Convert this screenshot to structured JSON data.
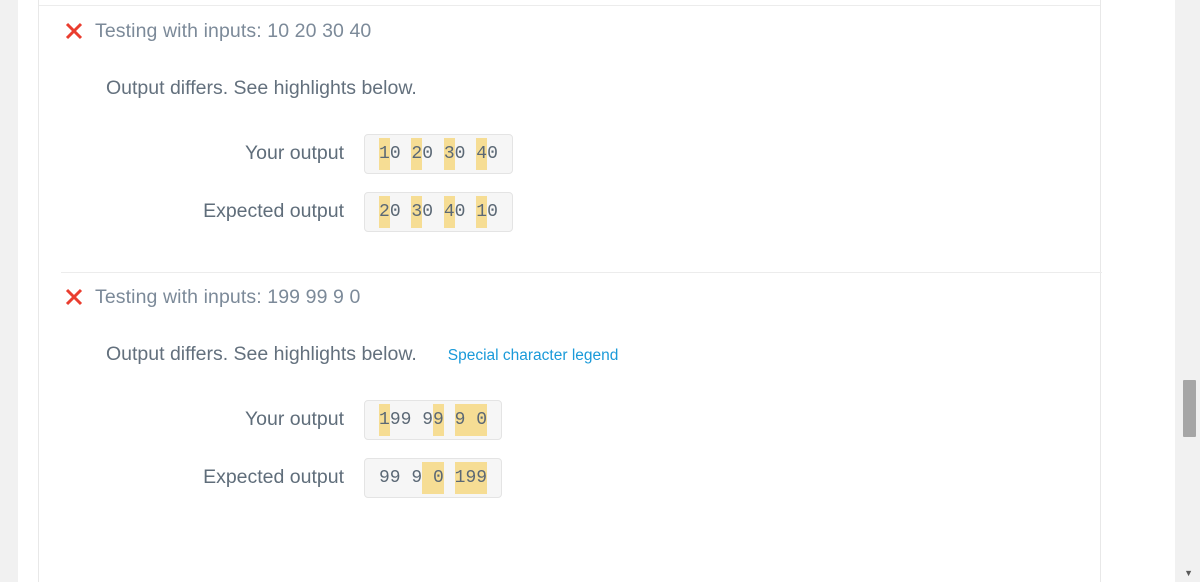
{
  "scrollbar": {
    "down_arrow_glyph": "▼"
  },
  "icons": {
    "fail": "x-mark-icon",
    "fail_color": "#ea3d2f"
  },
  "colors": {
    "highlight": "#f6dd94",
    "link": "#1a9ad9",
    "text_muted": "#7c8a99",
    "box_background": "#f6f6f6",
    "box_border": "#e4e4e4"
  },
  "labels": {
    "your_output": "Your output",
    "expected_output": "Expected output"
  },
  "test_cases": [
    {
      "status": "fail",
      "title": "Testing with inputs: 10 20 30 40",
      "message": "Output differs. See highlights below.",
      "legend_link": null,
      "your_output": [
        {
          "text": "1",
          "highlight": true
        },
        {
          "text": "0 ",
          "highlight": false
        },
        {
          "text": "2",
          "highlight": true
        },
        {
          "text": "0 ",
          "highlight": false
        },
        {
          "text": "3",
          "highlight": true
        },
        {
          "text": "0 ",
          "highlight": false
        },
        {
          "text": "4",
          "highlight": true
        },
        {
          "text": "0",
          "highlight": false
        }
      ],
      "expected_output": [
        {
          "text": "2",
          "highlight": true
        },
        {
          "text": "0 ",
          "highlight": false
        },
        {
          "text": "3",
          "highlight": true
        },
        {
          "text": "0 ",
          "highlight": false
        },
        {
          "text": "4",
          "highlight": true
        },
        {
          "text": "0 ",
          "highlight": false
        },
        {
          "text": "1",
          "highlight": true
        },
        {
          "text": "0",
          "highlight": false
        }
      ],
      "your_output_text": "10 20 30 40",
      "expected_output_text": "20 30 40 10"
    },
    {
      "status": "fail",
      "title": "Testing with inputs: 199 99 9 0",
      "message": "Output differs. See highlights below.",
      "legend_link": "Special character legend",
      "your_output": [
        {
          "text": "1",
          "highlight": true
        },
        {
          "text": "99 9",
          "highlight": false
        },
        {
          "text": "9",
          "highlight": true
        },
        {
          "text": " ",
          "highlight": false
        },
        {
          "text": "9 0",
          "highlight": true
        }
      ],
      "expected_output": [
        {
          "text": "99 9",
          "highlight": false
        },
        {
          "text": " 0",
          "highlight": true
        },
        {
          "text": " ",
          "highlight": false
        },
        {
          "text": "199",
          "highlight": true
        }
      ],
      "your_output_text": "199 99 9 0",
      "expected_output_text": "99 9 0 199"
    }
  ]
}
